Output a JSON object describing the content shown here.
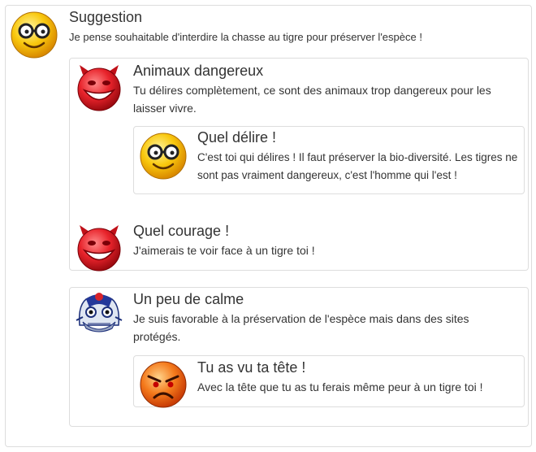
{
  "thread": [
    {
      "title": "Suggestion",
      "body": "Je pense souhaitable d'interdire la chasse au tigre pour préserver l'espèce !",
      "avatar": "nerd-glasses-smiley-icon"
    },
    {
      "title": "Animaux dangereux",
      "body": "Tu délires complètement, ce sont des animaux trop dangereux pour les laisser vivre.",
      "avatar": "devil-grin-smiley-icon"
    },
    {
      "title": "Quel délire !",
      "body": "C'est toi qui délires ! Il faut préserver la bio-diversité. Les tigres ne sont pas vraiment dangereux, c'est l'homme qui l'est !",
      "avatar": "nerd-glasses-smiley-icon"
    },
    {
      "title": "Quel courage !",
      "body": "J'aimerais te voir face à un tigre toi !",
      "avatar": "devil-grin-smiley-icon"
    },
    {
      "title": "Un peu de calme",
      "body": "Je suis favorable à la préservation de l'espèce mais dans des sites protégés.",
      "avatar": "lion-dance-mask-icon"
    },
    {
      "title": "Tu as vu ta tête !",
      "body": "Avec la tête que tu as tu ferais même peur à un tigre toi !",
      "avatar": "angry-smiley-icon"
    }
  ]
}
